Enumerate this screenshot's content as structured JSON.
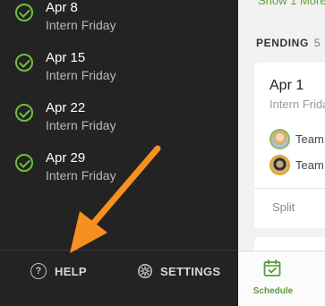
{
  "drawer": {
    "items": [
      {
        "date": "Apr 8",
        "subtitle": "Intern Friday"
      },
      {
        "date": "Apr 15",
        "subtitle": "Intern Friday"
      },
      {
        "date": "Apr 22",
        "subtitle": "Intern Friday"
      },
      {
        "date": "Apr 29",
        "subtitle": "Intern Friday"
      }
    ],
    "help_label": "HELP",
    "settings_label": "SETTINGS"
  },
  "main": {
    "show_more": "Show 1 More",
    "section_title": "PENDING",
    "section_count": "5",
    "card": {
      "date": "Apr 1",
      "subtitle": "Intern Friday",
      "members": [
        {
          "label": "Team"
        },
        {
          "label": "Team"
        }
      ],
      "split_label": "Split"
    }
  },
  "tabbar": {
    "schedule_label": "Schedule"
  },
  "icons": {
    "check": "check-circle-icon",
    "help": "help-icon",
    "settings": "gear-icon",
    "schedule": "calendar-check-icon"
  },
  "colors": {
    "drawer_bg": "#232323",
    "accent_green": "#5aa43b",
    "arrow_orange": "#f7901e"
  }
}
